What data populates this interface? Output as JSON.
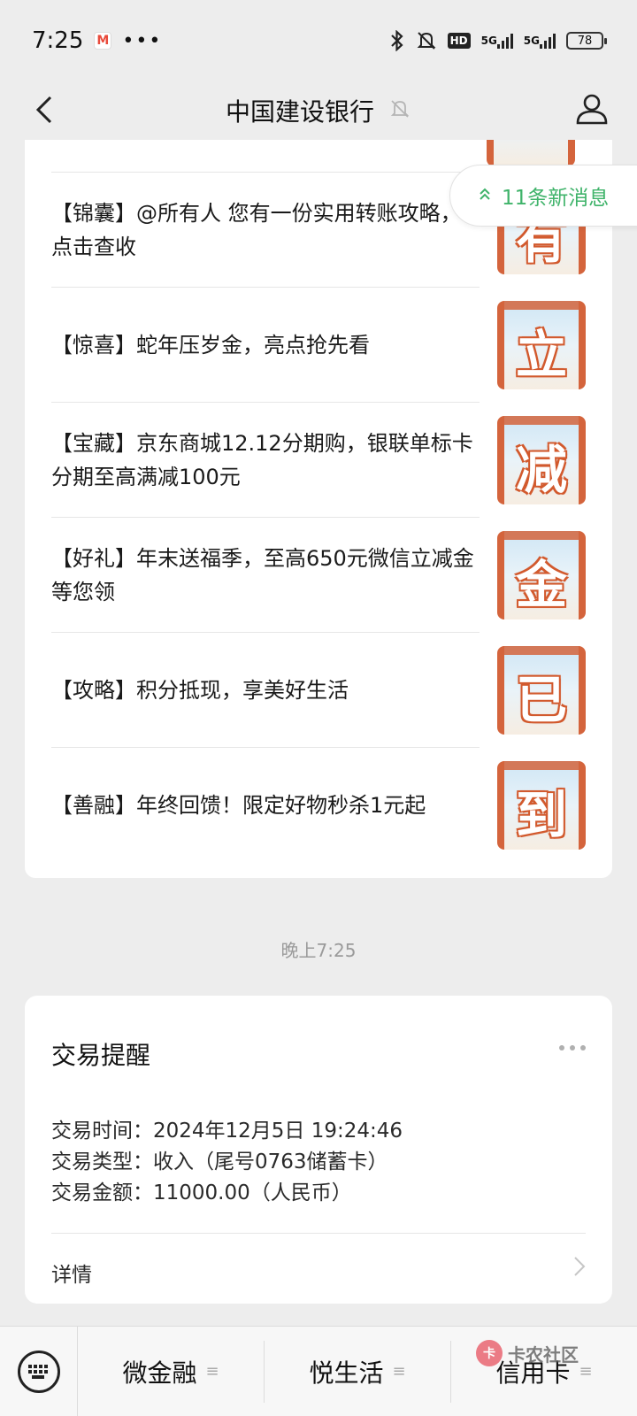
{
  "status_bar": {
    "time": "7:25",
    "more": "•••",
    "hd_label": "HD",
    "net1": "5G",
    "net2": "5G",
    "battery": "78"
  },
  "header": {
    "title": "中国建设银行"
  },
  "new_messages": {
    "label": "11条新消息"
  },
  "articles": [
    {
      "text": "【锦囊】@所有人 您有一份实用转账攻略，点击查收",
      "thumb_char": "有"
    },
    {
      "text": "【惊喜】蛇年压岁金，亮点抢先看",
      "thumb_char": "立"
    },
    {
      "text": "【宝藏】京东商城12.12分期购，银联单标卡分期至高满减100元",
      "thumb_char": "减"
    },
    {
      "text": "【好礼】年末送福季，至高650元微信立减金等您领",
      "thumb_char": "金"
    },
    {
      "text": "【攻略】积分抵现，享美好生活",
      "thumb_char": "已"
    },
    {
      "text": "【善融】年终回馈！限定好物秒杀1元起",
      "thumb_char": "到"
    }
  ],
  "time_separator": "晚上7:25",
  "transaction": {
    "title": "交易提醒",
    "time_line": "交易时间：2024年12月5日 19:24:46",
    "type_line": "交易类型：收入（尾号0763储蓄卡）",
    "amount_line": "交易金额：11000.00（人民币）",
    "detail_label": "详情"
  },
  "bottom_menu": {
    "items": [
      "微金融",
      "悦生活",
      "信用卡"
    ]
  },
  "watermark": {
    "text": "卡农社区"
  },
  "colors": {
    "accent_green": "#3fb36a",
    "thumb_orange": "#d4643c",
    "background": "#ededed"
  }
}
